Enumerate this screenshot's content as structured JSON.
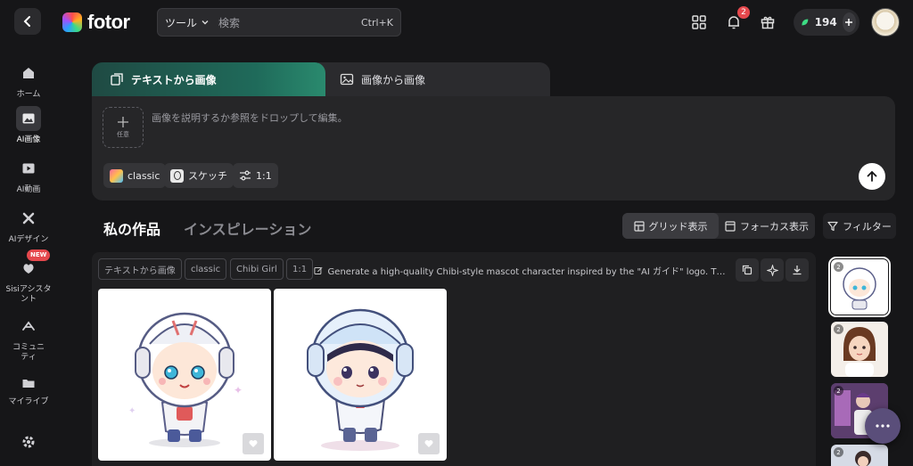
{
  "header": {
    "logo_text": "fotor",
    "search": {
      "tools_label": "ツール",
      "placeholder": "検索",
      "shortcut": "Ctrl+K"
    },
    "notification_count": "2",
    "credits": "194"
  },
  "sidebar": {
    "items": [
      {
        "label": "ホーム",
        "icon": "home-icon"
      },
      {
        "label": "AI画像",
        "icon": "image-ai-icon",
        "active": true
      },
      {
        "label": "AI動画",
        "icon": "video-ai-icon"
      },
      {
        "label": "AIデザイン",
        "icon": "design-icon"
      },
      {
        "label": "Sisiアシスタント",
        "icon": "assistant-icon",
        "badge": "NEW"
      },
      {
        "label": "コミュニティ",
        "icon": "community-icon"
      },
      {
        "label": "マイライブ",
        "icon": "folder-icon"
      }
    ]
  },
  "prompt": {
    "tabs": [
      {
        "label": "テキストから画像",
        "active": true
      },
      {
        "label": "画像から画像"
      }
    ],
    "upload_label": "任意",
    "placeholder": "画像を説明するか参照をドロップして編集。",
    "chips": {
      "model": "classic",
      "style": "スケッチ",
      "ratio": "1:1"
    }
  },
  "works": {
    "title": "私の作品",
    "inspiration": "インスピレーション",
    "grid_view": "グリッド表示",
    "focus_view": "フォーカス表示",
    "filter": "フィルター"
  },
  "group": {
    "tags": [
      "テキストから画像",
      "classic",
      "Chibi Girl",
      "1:1"
    ],
    "prompt_text": "Generate a high-quality Chibi-style mascot character inspired by the \"AI ガイド\" logo. The character..."
  },
  "thumbnails": [
    {
      "count": "2"
    },
    {
      "count": "2"
    },
    {
      "count": "2"
    },
    {
      "count": "2"
    }
  ],
  "colors": {
    "background": "#161618",
    "panel": "#262628",
    "accent": "#1f6a5a",
    "badge": "#e5484d"
  }
}
